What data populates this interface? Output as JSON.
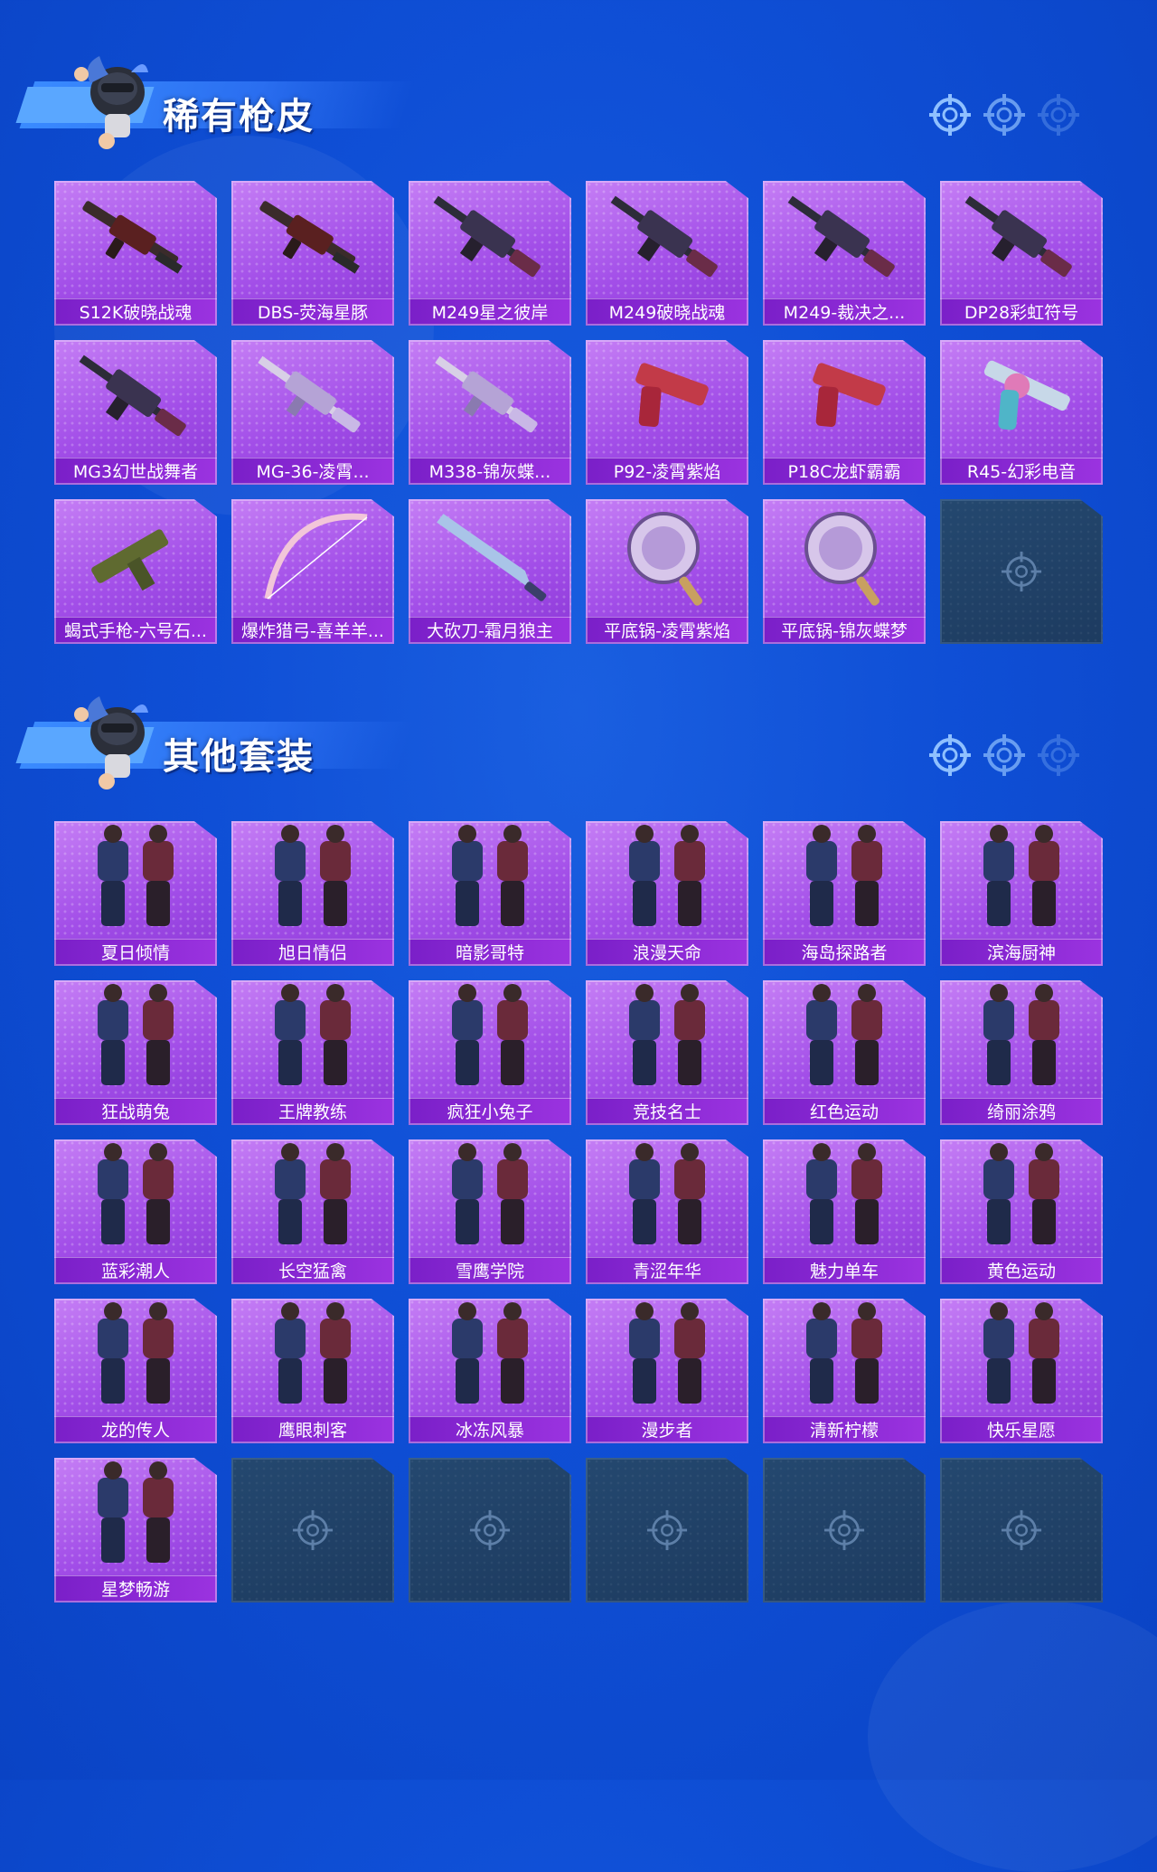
{
  "colors": {
    "background": "#0f4fd6",
    "card_purple": "#a24ee8",
    "label_purple": "#7a1fc8",
    "empty_slot": "#1d3b60",
    "title_text": "#ffffff"
  },
  "sections": [
    {
      "title": "稀有枪皮",
      "icon": "soldier-mascot-icon",
      "items": [
        {
          "label": "S12K破晓战魂",
          "icon": "shotgun-icon"
        },
        {
          "label": "DBS-荧海星豚",
          "icon": "shotgun-icon"
        },
        {
          "label": "M249星之彼岸",
          "icon": "machine-gun-icon"
        },
        {
          "label": "M249破晓战魂",
          "icon": "machine-gun-icon"
        },
        {
          "label": "M249-裁决之...",
          "icon": "machine-gun-icon"
        },
        {
          "label": "DP28彩虹符号",
          "icon": "machine-gun-icon"
        },
        {
          "label": "MG3幻世战舞者",
          "icon": "machine-gun-icon"
        },
        {
          "label": "MG-36-凌霄...",
          "icon": "rifle-icon"
        },
        {
          "label": "M338-锦灰蝶...",
          "icon": "rifle-icon"
        },
        {
          "label": "P92-凌霄紫焰",
          "icon": "pistol-icon"
        },
        {
          "label": "P18C龙虾霸霸",
          "icon": "pistol-icon"
        },
        {
          "label": "R45-幻彩电音",
          "icon": "revolver-icon"
        },
        {
          "label": "蝎式手枪-六号石...",
          "icon": "smg-icon"
        },
        {
          "label": "爆炸猎弓-喜羊羊...",
          "icon": "bow-icon"
        },
        {
          "label": "大砍刀-霜月狼主",
          "icon": "machete-icon"
        },
        {
          "label": "平底锅-凌霄紫焰",
          "icon": "pan-icon"
        },
        {
          "label": "平底锅-锦灰蝶梦",
          "icon": "pan-icon"
        }
      ],
      "empty_slots": 1
    },
    {
      "title": "其他套装",
      "icon": "soldier-mascot-icon",
      "items": [
        {
          "label": "夏日倾情",
          "icon": "outfit-icon"
        },
        {
          "label": "旭日情侣",
          "icon": "outfit-icon"
        },
        {
          "label": "暗影哥特",
          "icon": "outfit-icon"
        },
        {
          "label": "浪漫天命",
          "icon": "outfit-icon"
        },
        {
          "label": "海岛探路者",
          "icon": "outfit-icon"
        },
        {
          "label": "滨海厨神",
          "icon": "outfit-icon"
        },
        {
          "label": "狂战萌兔",
          "icon": "outfit-icon"
        },
        {
          "label": "王牌教练",
          "icon": "outfit-icon"
        },
        {
          "label": "疯狂小兔子",
          "icon": "outfit-icon"
        },
        {
          "label": "竞技名士",
          "icon": "outfit-icon"
        },
        {
          "label": "红色运动",
          "icon": "outfit-icon"
        },
        {
          "label": "绮丽涂鸦",
          "icon": "outfit-icon"
        },
        {
          "label": "蓝彩潮人",
          "icon": "outfit-icon"
        },
        {
          "label": "长空猛禽",
          "icon": "outfit-icon"
        },
        {
          "label": "雪鹰学院",
          "icon": "outfit-icon"
        },
        {
          "label": "青涩年华",
          "icon": "outfit-icon"
        },
        {
          "label": "魅力单车",
          "icon": "outfit-icon"
        },
        {
          "label": "黄色运动",
          "icon": "outfit-icon"
        },
        {
          "label": "龙的传人",
          "icon": "outfit-icon"
        },
        {
          "label": "鹰眼刺客",
          "icon": "outfit-icon"
        },
        {
          "label": "冰冻风暴",
          "icon": "outfit-icon"
        },
        {
          "label": "漫步者",
          "icon": "outfit-icon"
        },
        {
          "label": "清新柠檬",
          "icon": "outfit-icon"
        },
        {
          "label": "快乐星愿",
          "icon": "outfit-icon"
        },
        {
          "label": "星梦畅游",
          "icon": "outfit-icon"
        }
      ],
      "empty_slots": 5
    }
  ]
}
